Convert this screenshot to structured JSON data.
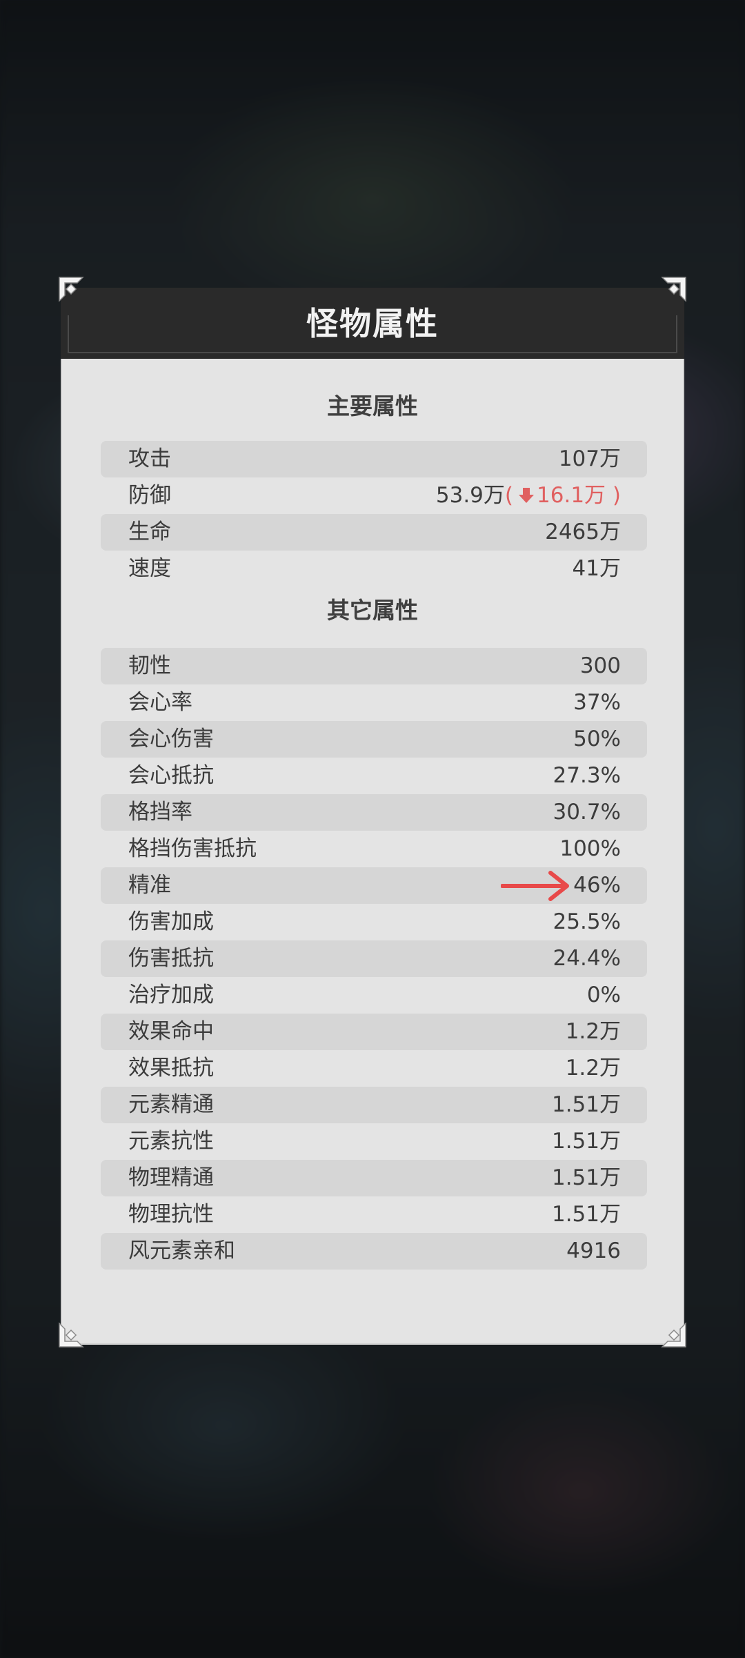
{
  "panel": {
    "title": "怪物属性"
  },
  "main_section": {
    "title": "主要属性",
    "rows": [
      {
        "label": "攻击",
        "value": "107万"
      },
      {
        "label": "防御",
        "value": "53.9万",
        "debuff_open": "(",
        "debuff_value": "16.1万",
        "debuff_close": " )"
      },
      {
        "label": "生命",
        "value": "2465万"
      },
      {
        "label": "速度",
        "value": "41万"
      }
    ]
  },
  "other_section": {
    "title": "其它属性",
    "rows": [
      {
        "label": "韧性",
        "value": "300"
      },
      {
        "label": "会心率",
        "value": "37%"
      },
      {
        "label": "会心伤害",
        "value": "50%"
      },
      {
        "label": "会心抵抗",
        "value": "27.3%"
      },
      {
        "label": "格挡率",
        "value": "30.7%"
      },
      {
        "label": "格挡伤害抵抗",
        "value": "100%"
      },
      {
        "label": "精准",
        "value": "46%"
      },
      {
        "label": "伤害加成",
        "value": "25.5%"
      },
      {
        "label": "伤害抵抗",
        "value": "24.4%"
      },
      {
        "label": "治疗加成",
        "value": "0%"
      },
      {
        "label": "效果命中",
        "value": "1.2万"
      },
      {
        "label": "效果抵抗",
        "value": "1.2万"
      },
      {
        "label": "元素精通",
        "value": "1.51万"
      },
      {
        "label": "元素抗性",
        "value": "1.51万"
      },
      {
        "label": "物理精通",
        "value": "1.51万"
      },
      {
        "label": "物理抗性",
        "value": "1.51万"
      },
      {
        "label": "风元素亲和",
        "value": "4916"
      }
    ]
  },
  "colors": {
    "debuff": "#e06060",
    "annotation_arrow": "#e84a4a",
    "header_bg": "#2a2a2a",
    "panel_bg": "#e4e4e4"
  },
  "icons": {
    "debuff_indicator": "down-arrow-icon",
    "annotation": "right-arrow-icon",
    "corner_ornament": "corner-ornament-icon"
  }
}
